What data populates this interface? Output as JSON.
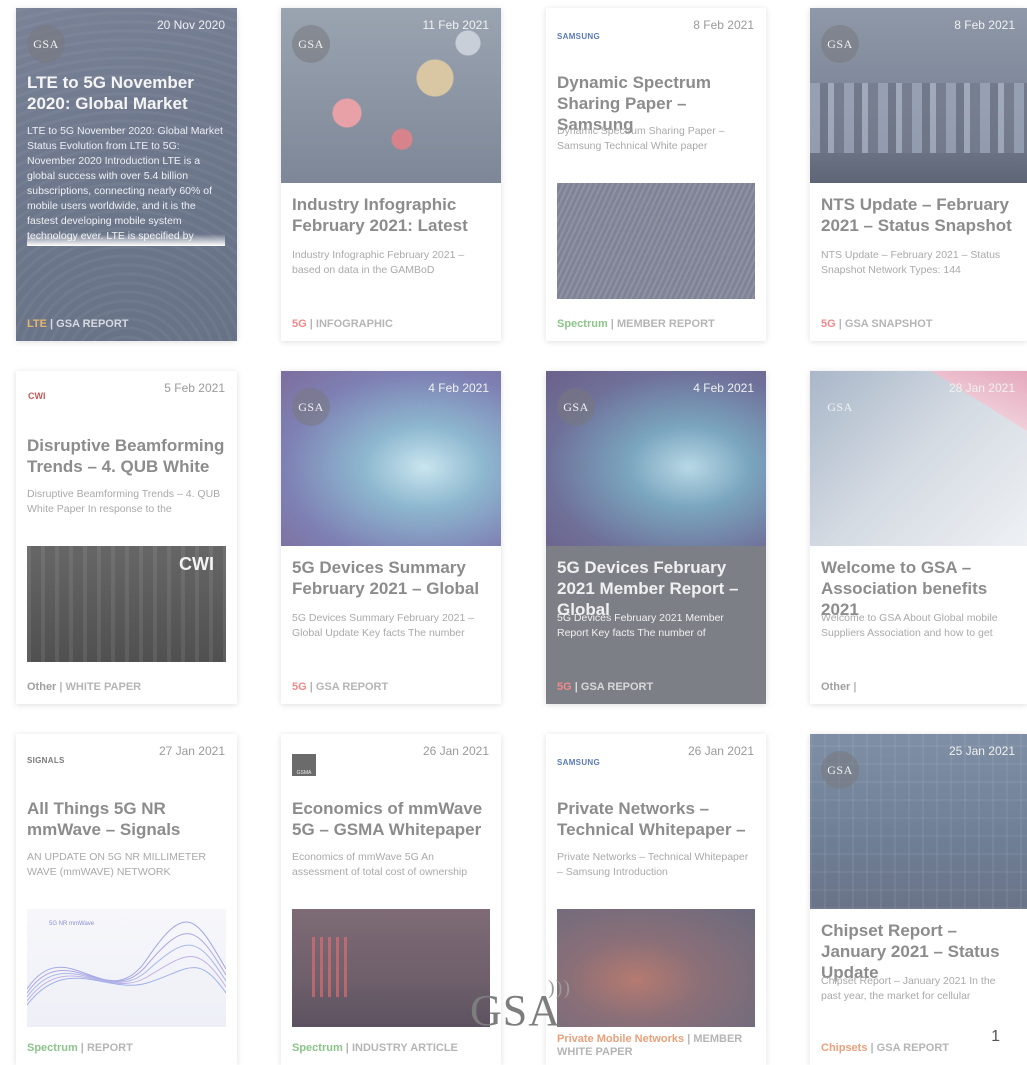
{
  "cards": [
    {
      "date": "20 Nov 2020",
      "badge": "GSA",
      "title": "LTE to 5G November 2020: Global Market",
      "excerpt": "LTE to 5G November 2020: Global Market Status Evolution from LTE to 5G: November 2020 Introduction LTE is a global success with over 5.4 billion subscriptions, connecting nearly 60% of mobile users worldwide, and it is the fastest developing mobile system technology ever. LTE is specified by",
      "category": "LTE",
      "type": "GSA REPORT"
    },
    {
      "date": "11 Feb 2021",
      "badge": "GSA",
      "title": "Industry Infographic February 2021: Latest",
      "excerpt": "Industry Infographic February 2021 – based on data in the GAMBoD",
      "category": "5G",
      "type": "INFOGRAPHIC"
    },
    {
      "date": "8 Feb 2021",
      "brand": "SAMSUNG",
      "title": "Dynamic Spectrum Sharing Paper – Samsung",
      "excerpt": "Dynamic Spectrum Sharing Paper – Samsung Technical White paper",
      "category": "Spectrum",
      "type": "MEMBER REPORT"
    },
    {
      "date": "8 Feb 2021",
      "badge": "GSA",
      "title": "NTS Update – February 2021 – Status Snapshot",
      "excerpt": "NTS Update – February 2021 – Status Snapshot Network Types: 144",
      "category": "5G",
      "type": "GSA SNAPSHOT"
    },
    {
      "date": "5 Feb 2021",
      "logo": "CWI",
      "title": "Disruptive Beamforming Trends – 4. QUB White",
      "excerpt": "Disruptive Beamforming Trends – 4. QUB White Paper In response to the",
      "media_label": "CWI",
      "category": "Other",
      "type": "WHITE PAPER"
    },
    {
      "date": "4 Feb 2021",
      "badge": "GSA",
      "title": "5G Devices Summary February 2021 – Global",
      "excerpt": "5G Devices Summary February 2021 – Global Update Key facts The number",
      "category": "5G",
      "type": "GSA REPORT"
    },
    {
      "date": "4 Feb 2021",
      "badge": "GSA",
      "title": "5G Devices February 2021 Member Report – Global",
      "excerpt": "5G Devices February 2021 Member Report Key facts The number of",
      "category": "5G",
      "type": "GSA REPORT"
    },
    {
      "date": "28 Jan 2021",
      "badge": "GSA",
      "title": "Welcome to GSA – Association benefits 2021",
      "excerpt": "Welcome to GSA About Global mobile Suppliers Association and how to get",
      "category": "Other",
      "type": ""
    },
    {
      "date": "27 Jan 2021",
      "brand": "SIGNALS",
      "title": "All Things 5G NR mmWave – Signals",
      "excerpt": "AN UPDATE ON 5G NR MILLIMETER WAVE (mmWAVE) NETWORK",
      "media_label": "5G NR mmWave",
      "category": "Spectrum",
      "type": "REPORT"
    },
    {
      "date": "26 Jan 2021",
      "logo": "GSMA",
      "title": "Economics of mmWave 5G – GSMA Whitepaper",
      "excerpt": "Economics of mmWave 5G An assessment of total cost of ownership",
      "category": "Spectrum",
      "type": "INDUSTRY ARTICLE"
    },
    {
      "date": "26 Jan 2021",
      "brand": "SAMSUNG",
      "title": "Private Networks – Technical Whitepaper –",
      "excerpt": "Private Networks – Technical Whitepaper – Samsung Introduction",
      "category": "Private Mobile Networks",
      "type": "MEMBER WHITE PAPER"
    },
    {
      "date": "25 Jan 2021",
      "badge": "GSA",
      "title": "Chipset Report – January 2021 – Status Update",
      "excerpt": "Chipset Report – January 2021 In the past year, the market for cellular",
      "category": "Chipsets",
      "type": "GSA REPORT"
    }
  ],
  "watermark": "GSA",
  "page_number": "1",
  "colors": {
    "orange": "#e7b56c",
    "red": "#ef8a8a",
    "green": "#8cc48a",
    "grey": "#a0a0a0"
  }
}
